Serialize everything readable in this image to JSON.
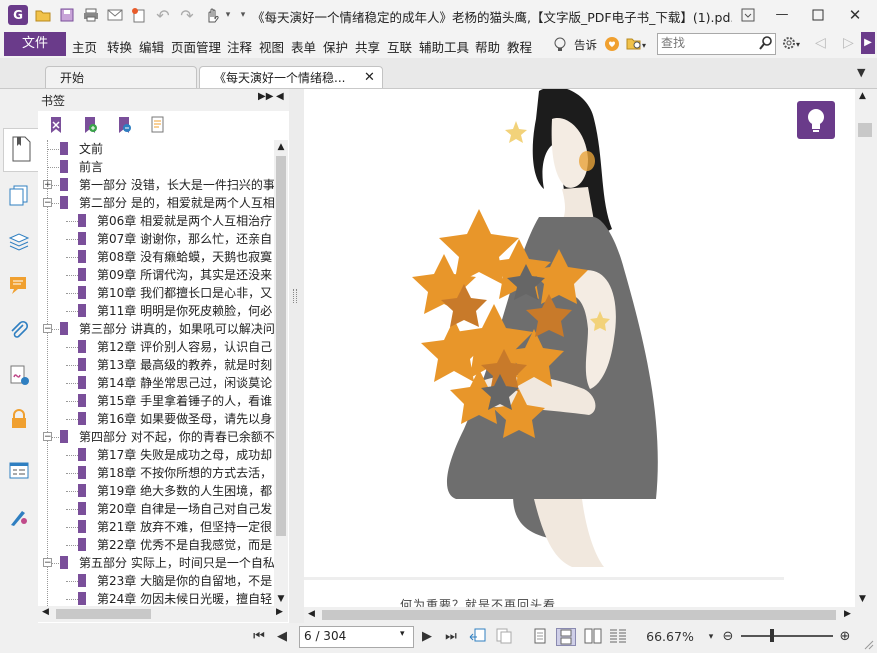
{
  "titlebar": {
    "title": "《每天演好一个情绪稳定的成年人》老杨的猫头鹰,【文字版_PDF电子书_下载】(1).pd..."
  },
  "menubar": {
    "file": "文件",
    "items": [
      "主页",
      "转换",
      "编辑",
      "页面管理",
      "注释",
      "视图",
      "表单",
      "保护",
      "共享",
      "互联",
      "辅助工具",
      "帮助",
      "教程"
    ],
    "tell_label": "告诉",
    "search_placeholder": "查找"
  },
  "tabs": [
    {
      "label": "开始"
    },
    {
      "label": "《每天演好一个情绪稳..."
    }
  ],
  "bookmark_panel": {
    "title": "书签",
    "items": [
      {
        "level": 0,
        "exp": "",
        "label": "文前"
      },
      {
        "level": 0,
        "exp": "",
        "label": "前言"
      },
      {
        "level": 0,
        "exp": "+",
        "label": "第一部分 没错，长大是一件扫兴的事"
      },
      {
        "level": 0,
        "exp": "-",
        "label": "第二部分 是的，相爱就是两个人互相"
      },
      {
        "level": 1,
        "exp": "",
        "label": "第06章 相爱就是两个人互相治疗"
      },
      {
        "level": 1,
        "exp": "",
        "label": "第07章 谢谢你，那么忙，还亲自"
      },
      {
        "level": 1,
        "exp": "",
        "label": "第08章 没有癞蛤蟆，天鹅也寂寞"
      },
      {
        "level": 1,
        "exp": "",
        "label": "第09章 所谓代沟，其实是还没来"
      },
      {
        "level": 1,
        "exp": "",
        "label": "第10章 我们都擅长口是心非，又"
      },
      {
        "level": 1,
        "exp": "",
        "label": "第11章 明明是你死皮赖脸，何必"
      },
      {
        "level": 0,
        "exp": "-",
        "label": "第三部分 讲真的，如果吼可以解决问"
      },
      {
        "level": 1,
        "exp": "",
        "label": "第12章 评价别人容易，认识自己"
      },
      {
        "level": 1,
        "exp": "",
        "label": "第13章 最高级的教养，就是时刻"
      },
      {
        "level": 1,
        "exp": "",
        "label": "第14章 静坐常思己过，闲谈莫论"
      },
      {
        "level": 1,
        "exp": "",
        "label": "第15章 手里拿着锤子的人，看谁"
      },
      {
        "level": 1,
        "exp": "",
        "label": "第16章 如果要做圣母，请先以身"
      },
      {
        "level": 0,
        "exp": "-",
        "label": "第四部分 对不起，你的青春已余额不"
      },
      {
        "level": 1,
        "exp": "",
        "label": "第17章 失败是成功之母，成功却"
      },
      {
        "level": 1,
        "exp": "",
        "label": "第18章 不按你所想的方式去活，"
      },
      {
        "level": 1,
        "exp": "",
        "label": "第19章 绝大多数的人生困境，都"
      },
      {
        "level": 1,
        "exp": "",
        "label": "第20章 自律是一场自己对自己发"
      },
      {
        "level": 1,
        "exp": "",
        "label": "第21章 放弃不难，但坚持一定很"
      },
      {
        "level": 1,
        "exp": "",
        "label": "第22章 优秀不是自我感觉，而是"
      },
      {
        "level": 0,
        "exp": "-",
        "label": "第五部分 实际上，时间只是一个自私"
      },
      {
        "level": 1,
        "exp": "",
        "label": "第23章 大脑是你的自留地，不是"
      },
      {
        "level": 1,
        "exp": "",
        "label": "第24章 勿因未候日光暖，擅自轻"
      }
    ]
  },
  "document": {
    "caption": "何为重要？就是不再回头看"
  },
  "statusbar": {
    "page_value": "6 / 304",
    "zoom": "66.67%"
  },
  "colors": {
    "accent": "#6a3b8a",
    "bookmark_flag": "#7a4f9a",
    "star_orange": "#e8962a",
    "dress_gray": "#6e6e6e"
  }
}
